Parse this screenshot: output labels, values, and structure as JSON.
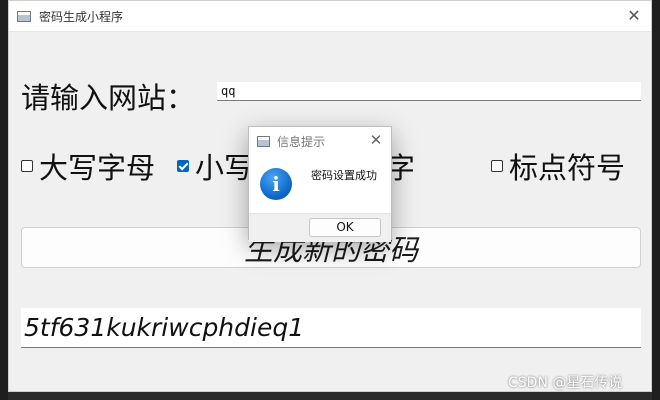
{
  "window": {
    "title": "密码生成小程序"
  },
  "form": {
    "url_label": "请输入网站：",
    "url_value": "qq"
  },
  "options": [
    {
      "label": "大写字母",
      "checked": false
    },
    {
      "label": "小写字母",
      "checked": true
    },
    {
      "label": "数字",
      "checked": false
    },
    {
      "label": "标点符号",
      "checked": false
    }
  ],
  "generate_button_label": "生成新的密码",
  "output_password": "5tf631kukriwcphdieq1",
  "dialog": {
    "title": "信息提示",
    "message": "密码设置成功",
    "ok_label": "OK",
    "icon": "info-icon"
  },
  "watermark": "CSDN @星石传说",
  "colors": {
    "accent": "#0067c0",
    "window_bg": "#f0f0f0",
    "info_blue": "#0a64c6"
  }
}
